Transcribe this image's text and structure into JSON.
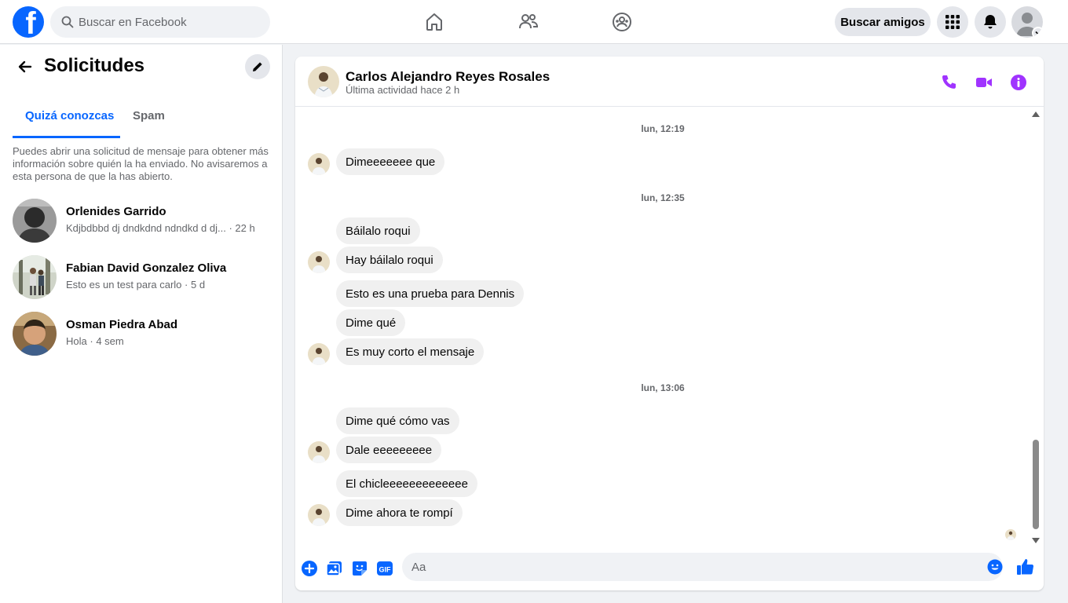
{
  "topbar": {
    "logo_letter": "f",
    "search_placeholder": "Buscar en Facebook",
    "find_friends_label": "Buscar amigos"
  },
  "left_panel": {
    "title": "Solicitudes",
    "tabs": [
      {
        "label": "Quizá conozcas",
        "active": true
      },
      {
        "label": "Spam",
        "active": false
      }
    ],
    "info_text": "Puedes abrir una solicitud de mensaje para obtener más información sobre quién la ha enviado. No avisaremos a esta persona de que la has abierto.",
    "requests": [
      {
        "name": "Orlenides Garrido",
        "snippet": "Kdjbdbbd dj dndkdnd ndndkd d dj...",
        "time": "22 h"
      },
      {
        "name": "Fabian David Gonzalez Oliva",
        "snippet": "Esto es un test para carlo",
        "time": "5 d"
      },
      {
        "name": "Osman Piedra Abad",
        "snippet": "Hola",
        "time": "4 sem"
      }
    ]
  },
  "chat": {
    "contact_name": "Carlos Alejandro Reyes Rosales",
    "last_active": "Última actividad hace 2 h",
    "timestamps": [
      "lun, 12:19",
      "lun, 12:35",
      "lun, 13:06"
    ],
    "messages": [
      "Dimeeeeeee que",
      "Báilalo roqui",
      "Hay báilalo roqui",
      "Esto es una prueba para Dennis",
      "Dime qué",
      "Es muy corto el mensaje",
      "Dime qué cómo vas",
      "Dale eeeeeeeee",
      "El chicleeeeeeeeeeeee",
      "Dime ahora te rompí"
    ],
    "composer_placeholder": "Aa"
  },
  "colors": {
    "accent": "#0866ff",
    "messenger_purple": "#a033ff",
    "bubble": "#f0f0f0"
  }
}
